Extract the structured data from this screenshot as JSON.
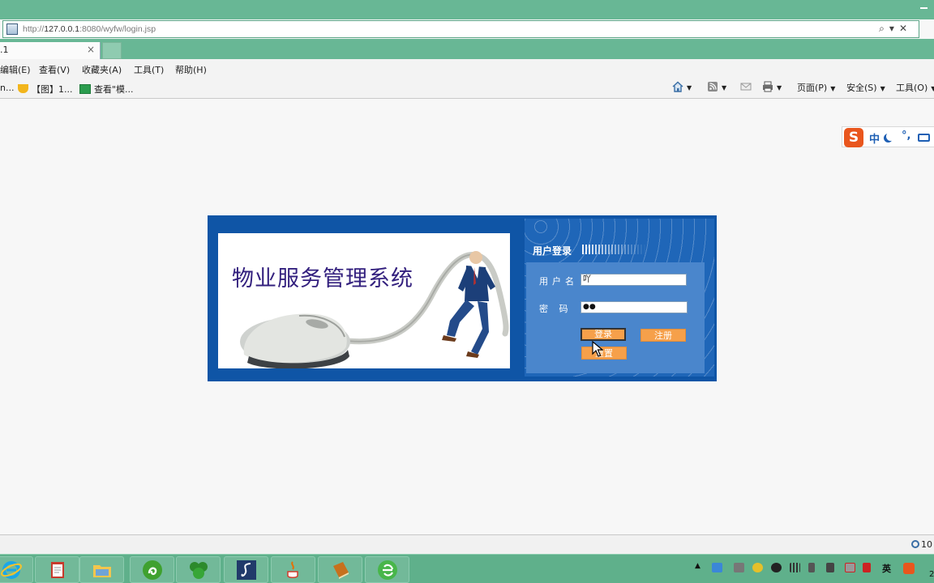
{
  "browser": {
    "address": {
      "prefix": "http://",
      "host": "127.0.0.1",
      "path": ":8080/wyfw/login.jsp"
    },
    "tab": {
      "title": ".1",
      "close": "×"
    },
    "menu": [
      "编辑(E)",
      "查看(V)",
      "收藏夹(A)",
      "工具(T)",
      "帮助(H)"
    ],
    "favorites": [
      "n...",
      "【图】1...",
      "查看\"模..."
    ],
    "commands": {
      "page": "页面(P)",
      "safety": "安全(S)",
      "tools": "工具(O)"
    }
  },
  "ime": {
    "lang": "中",
    "punct": "°,"
  },
  "login": {
    "system_title": "物业服务管理系统",
    "form_title": "用户登录",
    "username_label": "用户名",
    "username_value": "吖",
    "password_label": "密 码",
    "password_value": "●●",
    "login_button": "登录",
    "register_button": "注册",
    "reset_button": "重置"
  },
  "statusbar": {
    "zoom": "10"
  },
  "tray": {
    "ime": "英",
    "clock": "2"
  },
  "colors": {
    "accent": "#68b795",
    "panel": "#0f55a6",
    "button": "#f6a04a",
    "title": "#33207e"
  }
}
